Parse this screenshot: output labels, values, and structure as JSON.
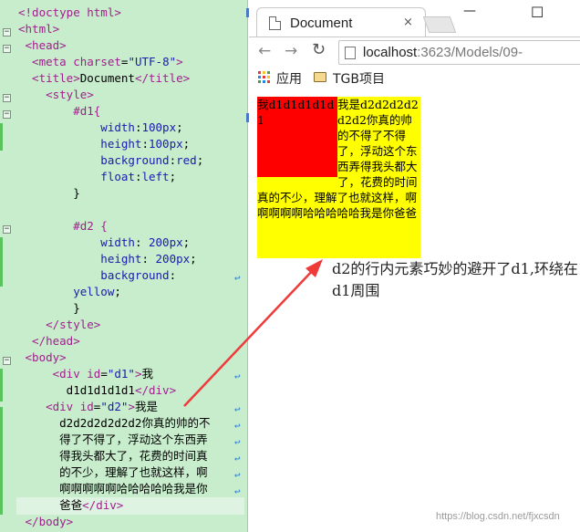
{
  "editor": {
    "lines": [
      {
        "parts": [
          [
            "t-tag",
            "<!doctype html>"
          ]
        ]
      },
      {
        "parts": [
          [
            "t-tag",
            "<html>"
          ]
        ]
      },
      {
        "parts": [
          [
            "t-tag",
            " <head>"
          ]
        ]
      },
      {
        "parts": [
          [
            "t-tag",
            "  <meta "
          ],
          [
            "t-attr",
            "charset"
          ],
          [
            "t-text",
            "="
          ],
          [
            "t-str",
            "\"UTF-8\""
          ],
          [
            "t-tag",
            ">"
          ]
        ]
      },
      {
        "parts": [
          [
            "t-tag",
            "  <title>"
          ],
          [
            "t-text",
            "Document"
          ],
          [
            "t-tag",
            "</title>"
          ]
        ]
      },
      {
        "parts": [
          [
            "t-tag",
            "    <style>"
          ]
        ]
      },
      {
        "parts": [
          [
            "t-sel",
            "        #d1{"
          ]
        ]
      },
      {
        "parts": [
          [
            "t-prop",
            "            width"
          ],
          [
            "t-text",
            ":"
          ],
          [
            "t-str",
            "100px"
          ],
          [
            "t-text",
            ";"
          ]
        ]
      },
      {
        "parts": [
          [
            "t-prop",
            "            height"
          ],
          [
            "t-text",
            ":"
          ],
          [
            "t-str",
            "100px"
          ],
          [
            "t-text",
            ";"
          ]
        ]
      },
      {
        "parts": [
          [
            "t-prop",
            "            background"
          ],
          [
            "t-text",
            ":"
          ],
          [
            "t-str",
            "red"
          ],
          [
            "t-text",
            ";"
          ]
        ]
      },
      {
        "parts": [
          [
            "t-prop",
            "            float"
          ],
          [
            "t-text",
            ":"
          ],
          [
            "t-str",
            "left"
          ],
          [
            "t-text",
            ";"
          ]
        ]
      },
      {
        "parts": [
          [
            "t-text",
            "        }"
          ]
        ]
      },
      {
        "parts": [
          [
            "t-text",
            ""
          ]
        ]
      },
      {
        "parts": [
          [
            "t-sel",
            "        #d2 {"
          ]
        ]
      },
      {
        "parts": [
          [
            "t-prop",
            "            width"
          ],
          [
            "t-text",
            ": "
          ],
          [
            "t-str",
            "200px"
          ],
          [
            "t-text",
            ";"
          ]
        ]
      },
      {
        "parts": [
          [
            "t-prop",
            "            height"
          ],
          [
            "t-text",
            ": "
          ],
          [
            "t-str",
            "200px"
          ],
          [
            "t-text",
            ";"
          ]
        ]
      },
      {
        "parts": [
          [
            "t-prop",
            "            background"
          ],
          [
            "t-text",
            ":"
          ]
        ]
      },
      {
        "parts": [
          [
            "t-str",
            "        yellow"
          ],
          [
            "t-text",
            ";"
          ]
        ]
      },
      {
        "parts": [
          [
            "t-text",
            "        }"
          ]
        ]
      },
      {
        "parts": [
          [
            "t-tag",
            "    </style>"
          ]
        ]
      },
      {
        "parts": [
          [
            "t-tag",
            "  </head>"
          ]
        ]
      },
      {
        "parts": [
          [
            "t-tag",
            " <body>"
          ]
        ]
      },
      {
        "parts": [
          [
            "t-tag",
            "     <div "
          ],
          [
            "t-attr",
            "id"
          ],
          [
            "t-text",
            "="
          ],
          [
            "t-str",
            "\"d1\""
          ],
          [
            "t-tag",
            ">"
          ],
          [
            "t-text",
            "我"
          ]
        ]
      },
      {
        "parts": [
          [
            "t-text",
            "       d1d1d1d1d1"
          ],
          [
            "t-tag",
            "</div>"
          ]
        ]
      },
      {
        "parts": [
          [
            "t-tag",
            "    <div "
          ],
          [
            "t-attr",
            "id"
          ],
          [
            "t-text",
            "="
          ],
          [
            "t-str",
            "\"d2\""
          ],
          [
            "t-tag",
            ">"
          ],
          [
            "t-text",
            "我是"
          ]
        ]
      },
      {
        "parts": [
          [
            "t-text",
            "      d2d2d2d2d2d2你真的帅的不"
          ]
        ]
      },
      {
        "parts": [
          [
            "t-text",
            "      得了不得了，浮动这个东西弄"
          ]
        ]
      },
      {
        "parts": [
          [
            "t-text",
            "      得我头都大了，花费的时间真"
          ]
        ]
      },
      {
        "parts": [
          [
            "t-text",
            "      的不少，理解了也就这样，啊"
          ]
        ]
      },
      {
        "parts": [
          [
            "t-text",
            "      啊啊啊啊啊哈哈哈哈哈我是你"
          ]
        ]
      },
      {
        "parts": [
          [
            "t-text",
            "      爸爸"
          ],
          [
            "t-tag",
            "</div>"
          ]
        ]
      },
      {
        "parts": [
          [
            "t-tag",
            " </body>"
          ]
        ]
      }
    ]
  },
  "browser": {
    "tab_title": "Document",
    "tab_close": "×",
    "url_host": "localhost",
    "url_rest": ":3623/Models/09-",
    "bookmarks": {
      "apps": "应用",
      "folder": "TGB项目"
    },
    "window_controls": {
      "minimize": "—",
      "maximize": "☐"
    }
  },
  "page": {
    "d1_text": "我d1d1d1d1d1",
    "d2_text": "我是d2d2d2d2d2d2你真的帅的不得了不得了，浮动这个东西弄得我头都大了，花费的时间真的不少，理解了也就这样，啊啊啊啊啊哈哈哈哈哈我是你爸爸",
    "note": "d2的行内元素巧妙的避开了d1,环绕在d1周围",
    "colors": {
      "d1": "#ff0000",
      "d2": "#ffff00"
    }
  },
  "watermark": "https://blog.csdn.net/fjxcsdn"
}
